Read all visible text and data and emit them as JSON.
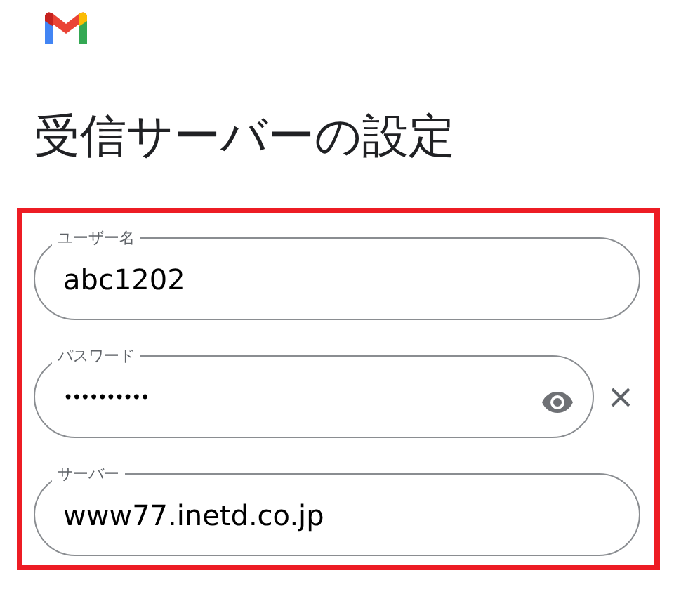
{
  "title": "受信サーバーの設定",
  "fields": [
    {
      "label": "ユーザー名",
      "value": "abc1202",
      "kind": "text",
      "clearable": false
    },
    {
      "label": "パスワード",
      "value": "••••••••••",
      "kind": "password",
      "clearable": true
    },
    {
      "label": "サーバー",
      "value": "www77.inetd.co.jp",
      "kind": "text",
      "clearable": false
    }
  ]
}
